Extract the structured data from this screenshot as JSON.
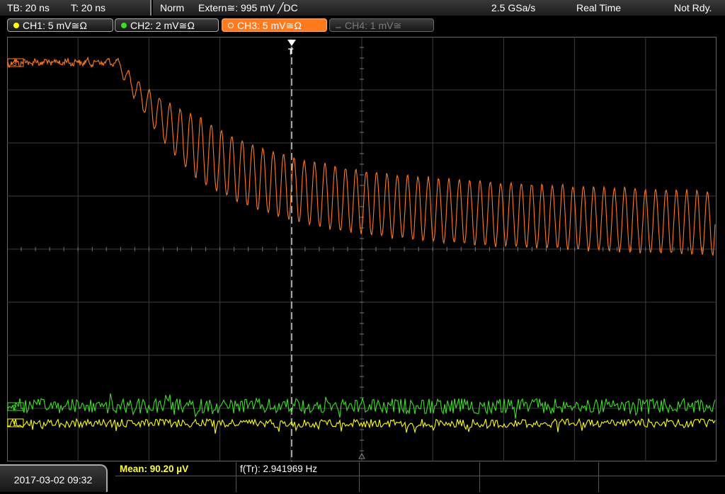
{
  "top": {
    "timebase": "TB: 20 ns",
    "trigger_time": "T: 20 ns",
    "mode": "Norm",
    "trigger_source": "Extern≅: 995 mV ╱DC",
    "sample_rate": "2.5 GSa/s",
    "acq_mode": "Real Time",
    "state": "Not Rdy."
  },
  "channels": [
    {
      "label": "CH1: 5 mV≅Ω",
      "color": "#ffff00",
      "active": false,
      "enabled": true
    },
    {
      "label": "CH2: 2 mV≅Ω",
      "color": "#39e020",
      "active": false,
      "enabled": true
    },
    {
      "label": "CH3: 5 mV≅Ω",
      "color": "#ff7a1c",
      "active": true,
      "enabled": true
    },
    {
      "label": "CH4: 1 mV≅",
      "color": "#777777",
      "active": false,
      "enabled": false
    }
  ],
  "markers": {
    "ch3": "3",
    "ch2": "2",
    "ch1": "1",
    "trigger": "T"
  },
  "bottom": {
    "datetime": "2017-03-02 09:32",
    "mean": "Mean: 90.20 µV",
    "freq": "f(Tr): 2.941969 Hz"
  },
  "colors": {
    "ch1": "#ffff00",
    "ch2": "#39e020",
    "ch3": "#ff7a1c",
    "grid": "#3c3c3c"
  }
}
